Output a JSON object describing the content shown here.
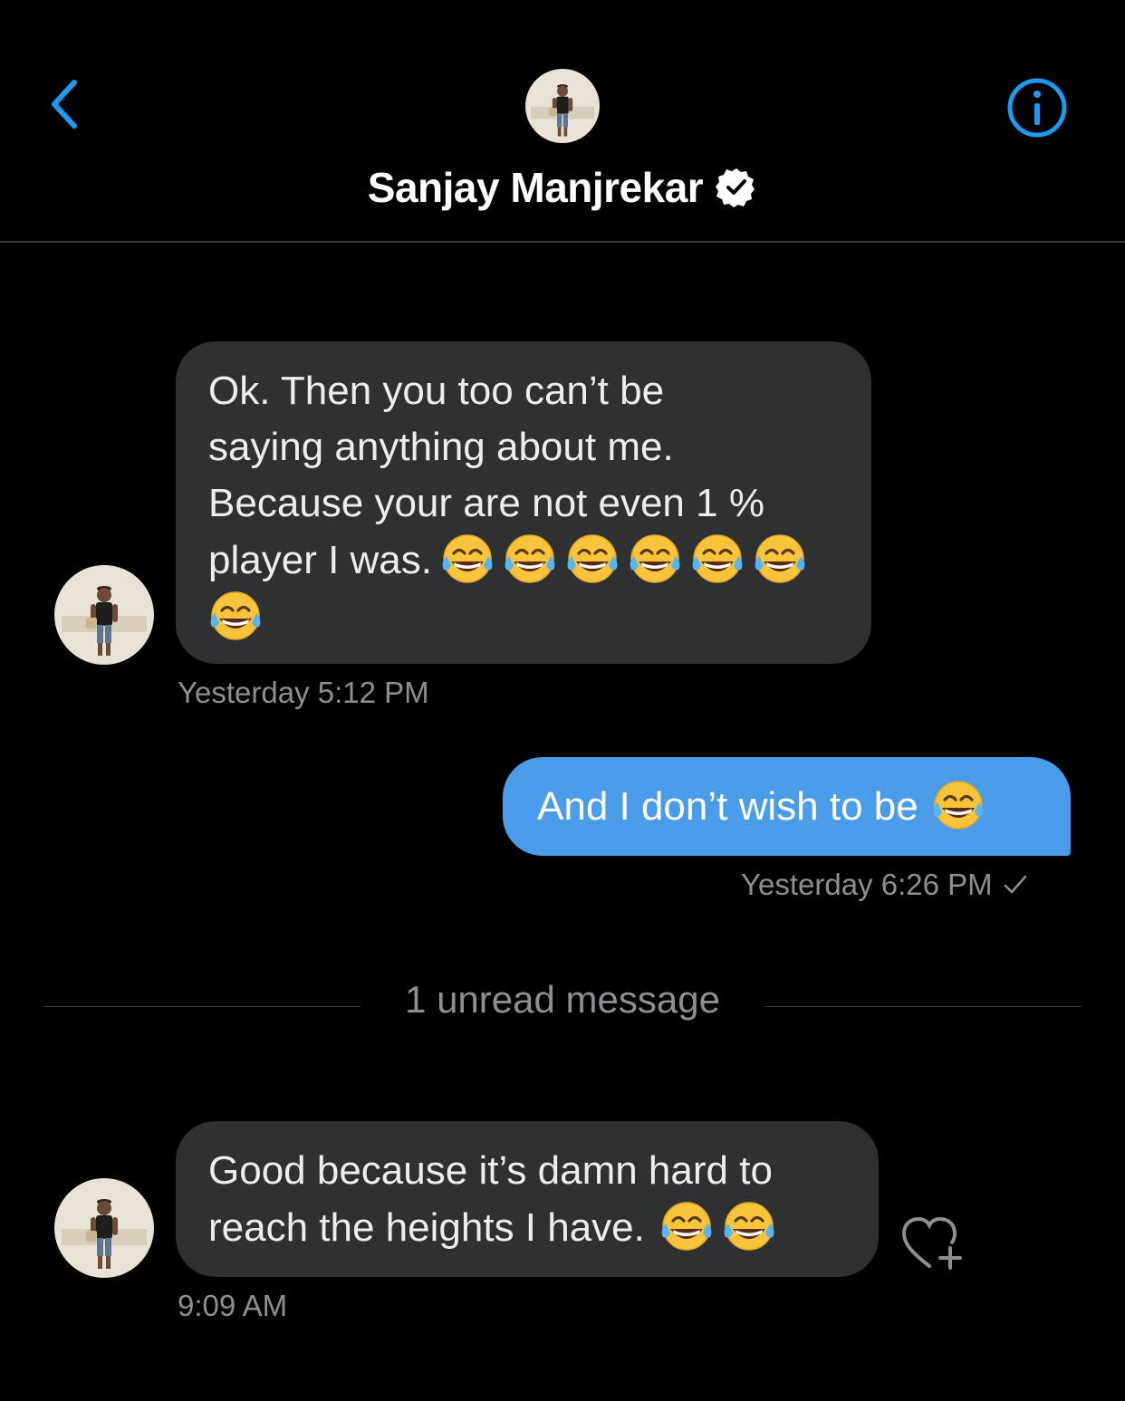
{
  "header": {
    "contact_name": "Sanjay Manjrekar",
    "verified": true,
    "back_icon": "chevron-left-icon",
    "info_icon": "info-icon"
  },
  "messages": [
    {
      "direction": "incoming",
      "text_line1": "Ok. Then you too can’t be",
      "text_line2": "saying anything about me.",
      "text_line3": "Because your are not even 1 %",
      "text_line4": "player I was.",
      "emoji": "face-with-tears-of-joy",
      "emoji_count": 7,
      "timestamp": "Yesterday 5:12 PM"
    },
    {
      "direction": "outgoing",
      "text": "And I don’t wish to be",
      "emoji": "face-with-tears-of-joy",
      "emoji_count": 1,
      "timestamp": "Yesterday 6:26 PM",
      "status_icon": "checkmark-icon"
    },
    {
      "direction": "incoming",
      "text_line1": "Good because it’s damn hard to",
      "text_line2": "reach the heights I have.",
      "emoji": "face-with-tears-of-joy",
      "emoji_count": 2,
      "timestamp": "9:09 AM",
      "reaction_icon": "heart-plus-icon"
    }
  ],
  "unread_divider": {
    "label": "1 unread message"
  },
  "colors": {
    "background": "#000000",
    "incoming_bubble": "#2f3032",
    "outgoing_bubble": "#4a9be8",
    "accent": "#1d9bf0",
    "secondary_text": "#8e8e93"
  }
}
